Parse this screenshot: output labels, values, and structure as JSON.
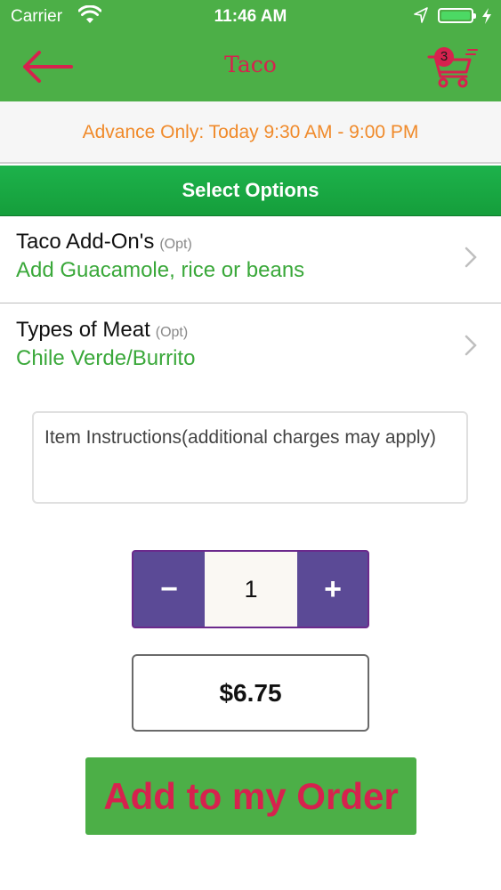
{
  "status_bar": {
    "carrier": "Carrier",
    "time": "11:46 AM",
    "icons": [
      "wifi-icon",
      "location-arrow-icon",
      "battery-icon",
      "charging-bolt-icon"
    ]
  },
  "nav": {
    "title": "Taco",
    "cart_count": "3",
    "icons": [
      "back-arrow-icon",
      "shopping-cart-icon"
    ]
  },
  "notice": "Advance Only: Today 9:30 AM - 9:00 PM",
  "section_header": "Select Options",
  "options": [
    {
      "name": "Taco Add-On's",
      "tag": "(Opt)",
      "value": "Add Guacamole, rice or beans"
    },
    {
      "name": "Types of Meat",
      "tag": "(Opt)",
      "value": "Chile Verde/Burrito"
    }
  ],
  "instructions": {
    "placeholder": "Item Instructions(additional charges may apply)"
  },
  "quantity": {
    "minus_label": "−",
    "value": "1",
    "plus_label": "+"
  },
  "price": "$6.75",
  "add_button_label": "Add to my Order",
  "colors": {
    "nav_green": "#4caf47",
    "header_green": "#1db24b",
    "accent_red": "#d6224e",
    "notice_orange": "#f08a2a",
    "option_value_green": "#3aa83a",
    "stepper_purple": "#5b4a96"
  }
}
